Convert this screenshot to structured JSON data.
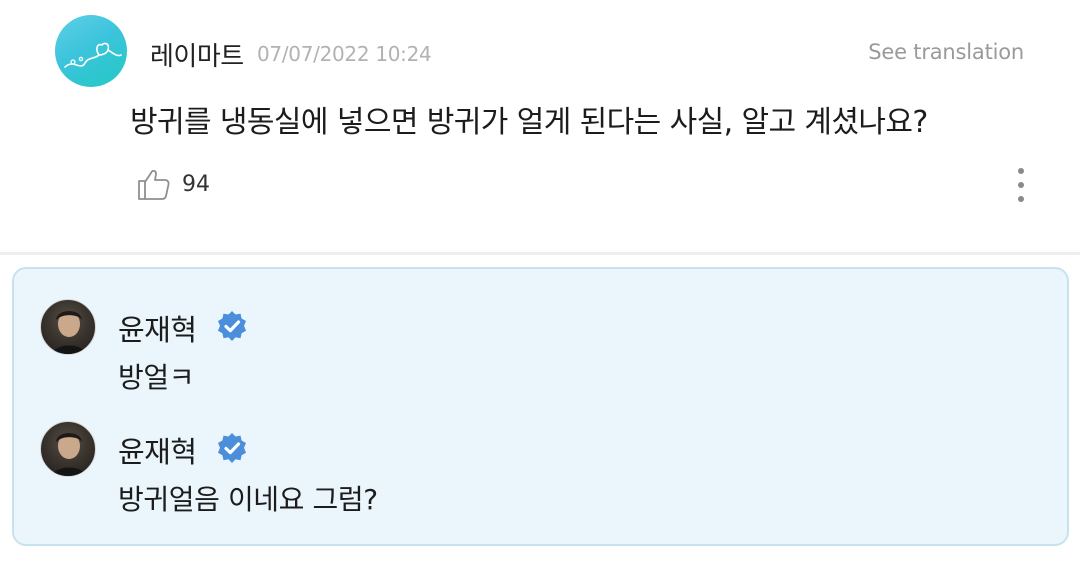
{
  "post": {
    "author": "레이마트",
    "timestamp": "07/07/2022 10:24",
    "translate_label": "See translation",
    "text": "방귀를 냉동실에 넣으면 방귀가 얼게 된다는 사실, 알고 계셨나요?",
    "likes": "94",
    "avatar_icon": "heart-doodle-icon",
    "like_icon": "thumbs-up-icon",
    "more_icon": "more-vertical-icon"
  },
  "replies": [
    {
      "author": "윤재혁",
      "verified": true,
      "text": "방얼ㅋ"
    },
    {
      "author": "윤재혁",
      "verified": true,
      "text": "방귀얼음 이네요 그럼?"
    }
  ],
  "colors": {
    "accent": "#4b8fdc",
    "reply_background": "#eaf6fc",
    "reply_border": "#c7e2ee",
    "timestamp": "#b2b2b2"
  }
}
